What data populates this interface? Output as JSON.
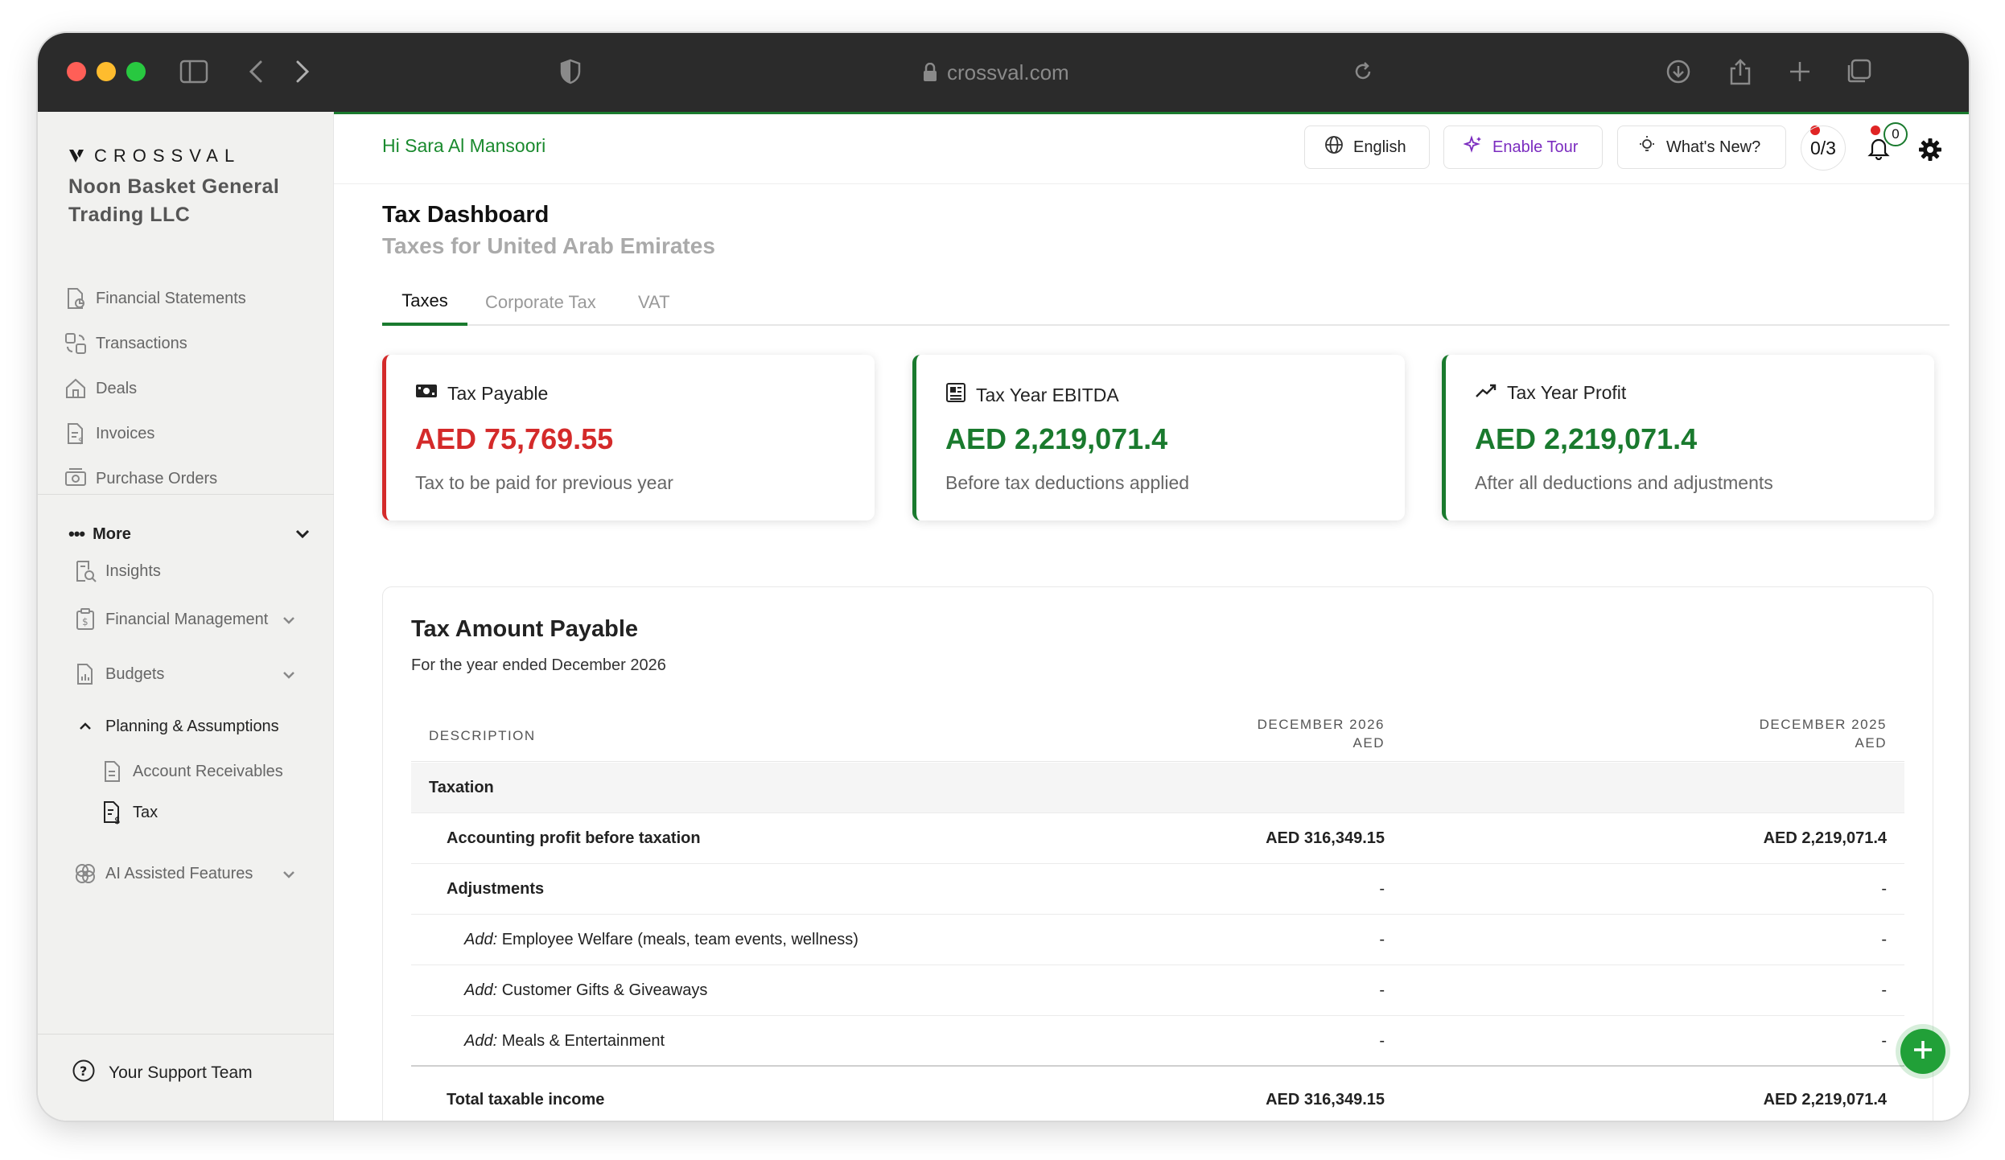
{
  "browser": {
    "url": "crossval.com"
  },
  "sidebar": {
    "brand": "CROSSVAL",
    "company": "Noon Basket General Trading LLC",
    "items": [
      {
        "label": "Financial Statements",
        "icon": "file-chart-icon"
      },
      {
        "label": "Transactions",
        "icon": "exchange-icon"
      },
      {
        "label": "Deals",
        "icon": "home-icon"
      },
      {
        "label": "Invoices",
        "icon": "invoice-icon"
      },
      {
        "label": "Purchase Orders",
        "icon": "purchase-order-icon"
      }
    ],
    "more_label": "More",
    "more_items": [
      {
        "label": "Insights",
        "icon": "insights-icon"
      },
      {
        "label": "Financial Management",
        "icon": "clipboard-dollar-icon"
      },
      {
        "label": "Budgets",
        "icon": "budget-icon"
      }
    ],
    "planning_label": "Planning & Assumptions",
    "planning_items": [
      {
        "label": "Account Receivables",
        "icon": "document-icon"
      },
      {
        "label": "Tax",
        "icon": "tax-document-icon"
      }
    ],
    "ai_label": "AI Assisted Features",
    "support_label": "Your Support Team"
  },
  "topbar": {
    "greeting": "Hi Sara Al Mansoori",
    "language": "English",
    "tour": "Enable Tour",
    "whats_new": "What's New?",
    "progress": "0/3",
    "notifications": "0"
  },
  "page": {
    "title": "Tax Dashboard",
    "subtitle": "Taxes for United Arab Emirates",
    "tabs": [
      "Taxes",
      "Corporate Tax",
      "VAT"
    ]
  },
  "cards": [
    {
      "title": "Tax Payable",
      "value": "AED 75,769.55",
      "desc": "Tax to be paid for previous year",
      "color": "#d42a2a"
    },
    {
      "title": "Tax Year EBITDA",
      "value": "AED 2,219,071.4",
      "desc": "Before tax deductions applied",
      "color": "#1a7a2e"
    },
    {
      "title": "Tax Year Profit",
      "value": "AED 2,219,071.4",
      "desc": "After all deductions and adjustments",
      "color": "#1a7a2e"
    }
  ],
  "table": {
    "title": "Tax Amount Payable",
    "subtitle": "For the year ended December 2026",
    "headers": {
      "description": "DESCRIPTION",
      "col1": "DECEMBER 2026",
      "col1_unit": "AED",
      "col2": "DECEMBER 2025",
      "col2_unit": "AED"
    },
    "section": "Taxation",
    "rows": [
      {
        "prefix": "",
        "label": "Accounting profit before taxation",
        "v1": "AED 316,349.15",
        "v2": "AED 2,219,071.4"
      },
      {
        "prefix": "",
        "label": "Adjustments",
        "v1": "-",
        "v2": "-"
      },
      {
        "prefix": "Add:",
        "label": " Employee Welfare (meals, team events, wellness)",
        "v1": "-",
        "v2": "-"
      },
      {
        "prefix": "Add:",
        "label": " Customer Gifts & Giveaways",
        "v1": "-",
        "v2": "-"
      },
      {
        "prefix": "Add:",
        "label": " Meals & Entertainment",
        "v1": "-",
        "v2": "-"
      },
      {
        "prefix": "",
        "label": "Total taxable income",
        "v1": "AED 316,349.15",
        "v2": "AED 2,219,071.4"
      }
    ]
  }
}
